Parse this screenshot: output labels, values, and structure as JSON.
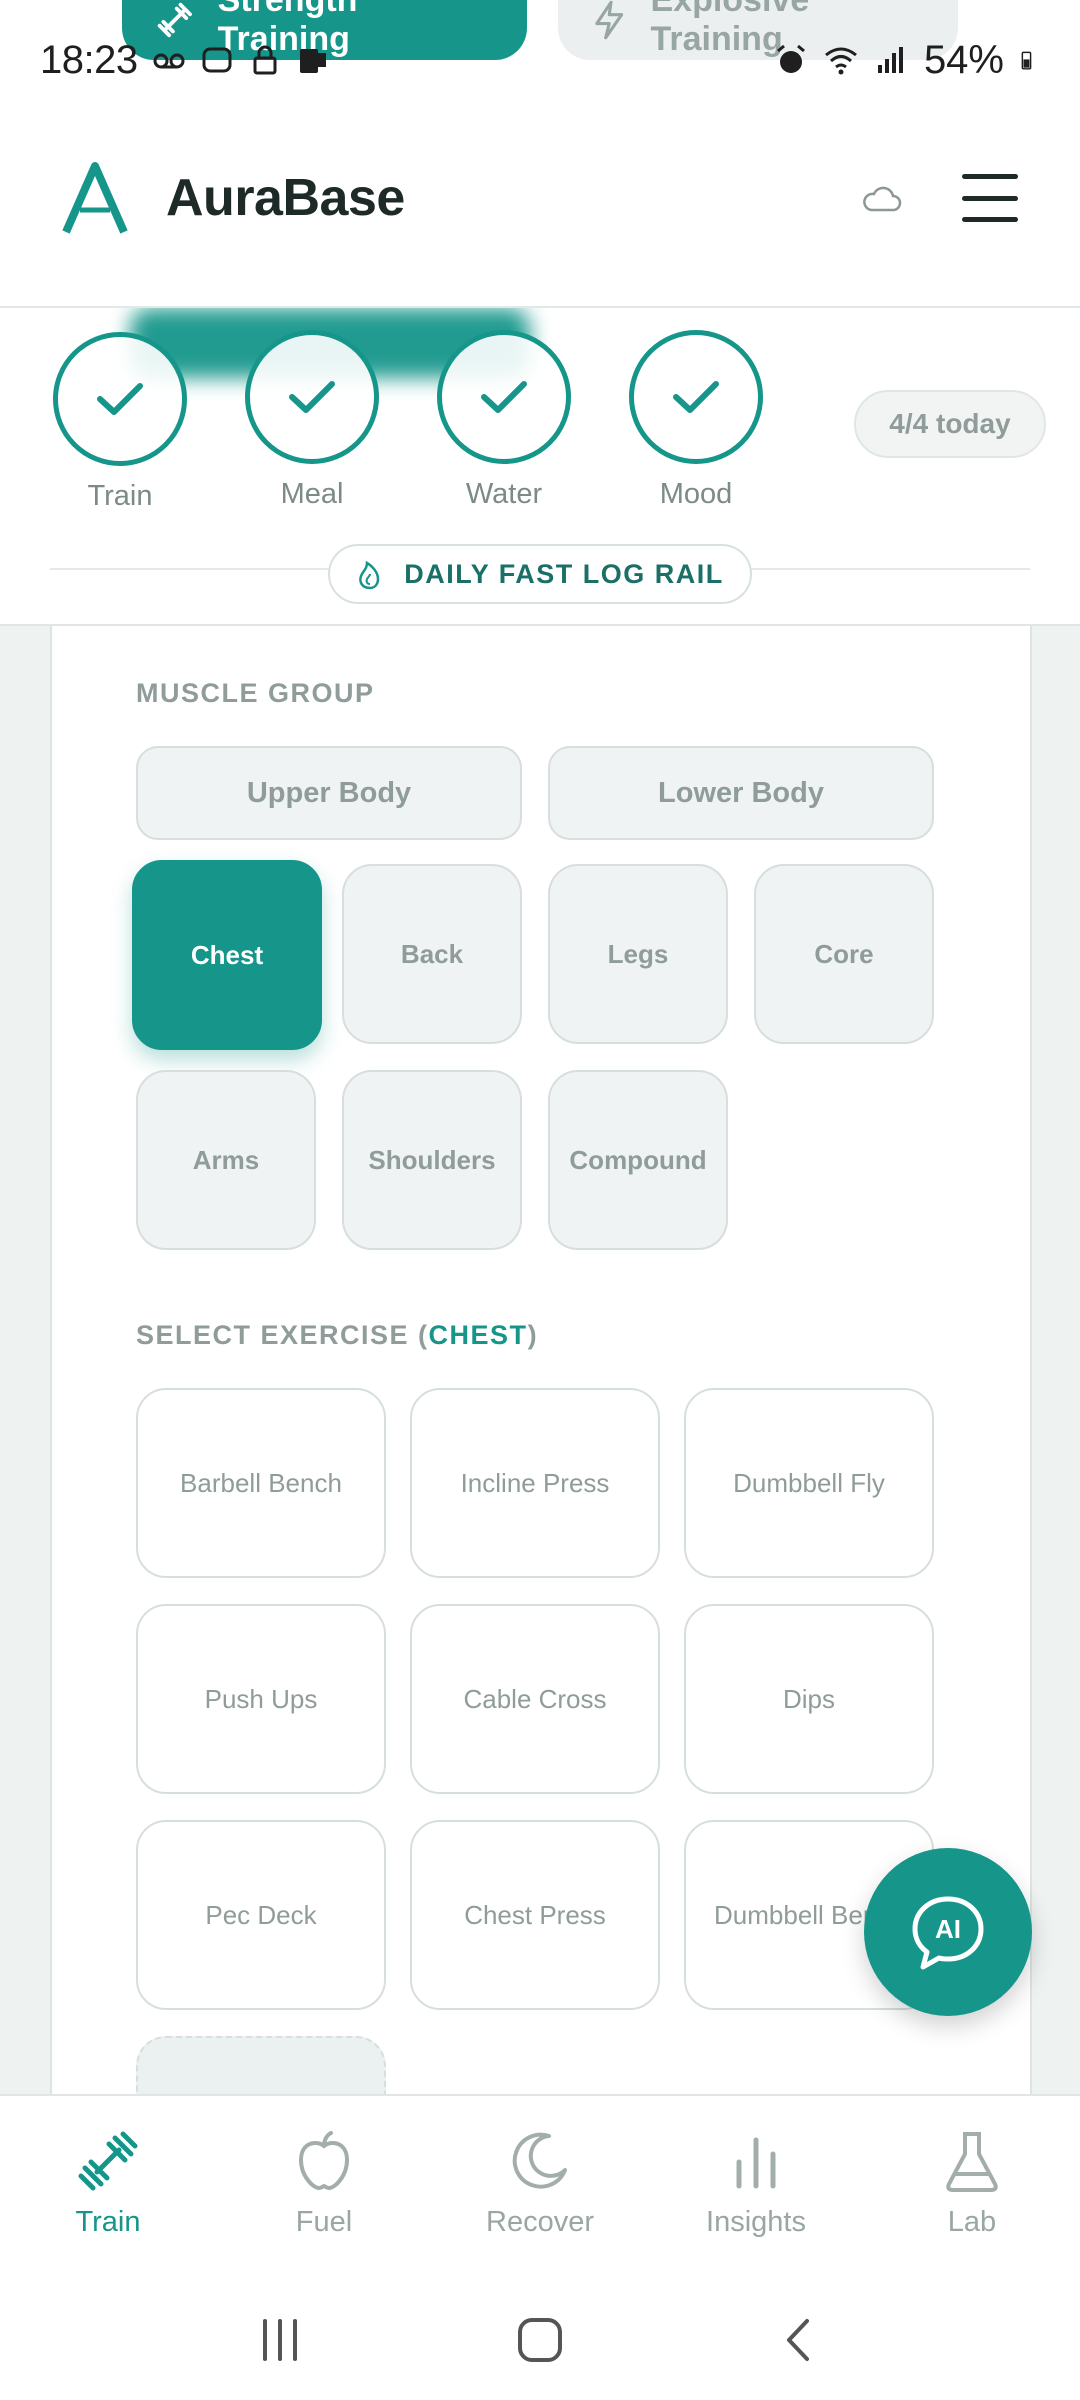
{
  "peek_tabs": [
    {
      "label": "Strength Training",
      "active": true,
      "icon": "dumbbell-icon"
    },
    {
      "label": "Explosive Training",
      "active": false,
      "icon": "lightning-icon"
    }
  ],
  "status_bar": {
    "time": "18:23",
    "battery": "54%"
  },
  "header": {
    "brand": "AuraBase"
  },
  "daily_rail": {
    "items": [
      {
        "label": "Train",
        "done": true
      },
      {
        "label": "Meal",
        "done": true
      },
      {
        "label": "Water",
        "done": true
      },
      {
        "label": "Mood",
        "done": true
      }
    ],
    "today_count": "4/4 today",
    "rail_label": "DAILY FAST LOG RAIL"
  },
  "muscle_group": {
    "title": "MUSCLE GROUP",
    "regions": [
      "Upper Body",
      "Lower Body"
    ],
    "groups": [
      "Chest",
      "Back",
      "Legs",
      "Core",
      "Arms",
      "Shoulders",
      "Compound"
    ],
    "selected": "Chest"
  },
  "exercise": {
    "title_prefix": "SELECT EXERCISE (",
    "title_group": "CHEST",
    "title_suffix": ")",
    "items": [
      "Barbell Bench",
      "Incline Press",
      "Dumbbell Fly",
      "Push Ups",
      "Cable Cross",
      "Dips",
      "Pec Deck",
      "Chest Press",
      "Dumbbell Bench"
    ]
  },
  "fab": {
    "label": "AI"
  },
  "bottom_nav": [
    {
      "label": "Train",
      "icon": "dumbbell-icon",
      "active": true
    },
    {
      "label": "Fuel",
      "icon": "apple-icon",
      "active": false
    },
    {
      "label": "Recover",
      "icon": "moon-icon",
      "active": false
    },
    {
      "label": "Insights",
      "icon": "bar-chart-icon",
      "active": false
    },
    {
      "label": "Lab",
      "icon": "flask-icon",
      "active": false
    }
  ],
  "colors": {
    "accent": "#16968a",
    "muted": "#8f9c9a",
    "text": "#1d2a28"
  }
}
